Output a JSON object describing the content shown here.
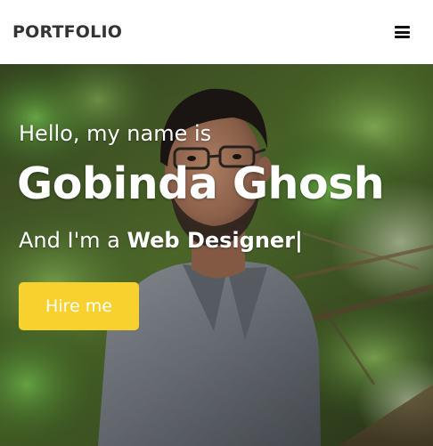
{
  "navbar": {
    "brand": "PORTFOLIO",
    "menu_icon": "hamburger-menu-icon"
  },
  "hero": {
    "greeting": "Hello, my name is",
    "name": "Gobinda Ghosh",
    "role_prefix": "And I'm a ",
    "role": "Web Designer",
    "cursor": "|",
    "hire_button": "Hire me"
  },
  "colors": {
    "navbar_bg": "#ffffff",
    "brand_text": "#333333",
    "hero_text": "#ffffff",
    "button_bg": "#f8d12f",
    "button_text": "#ffffff"
  }
}
